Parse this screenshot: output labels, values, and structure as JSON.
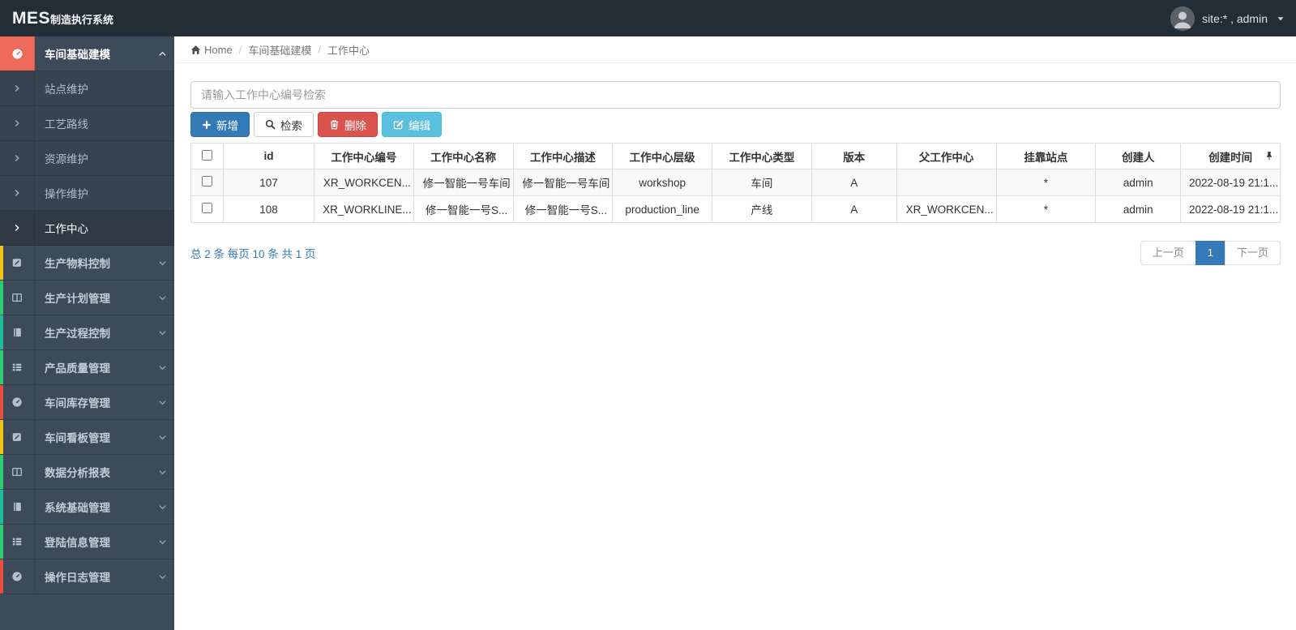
{
  "header": {
    "logo_primary": "MES",
    "logo_secondary": "制造执行系统",
    "user_label": "site:* , admin"
  },
  "breadcrumb": {
    "home": "Home",
    "section": "车间基础建模",
    "page": "工作中心"
  },
  "sidebar": {
    "sections": [
      {
        "label": "车间基础建模",
        "icon": "dashboard-icon",
        "state": "expanded",
        "accent": "#ee6a5b",
        "children": [
          {
            "label": "站点维护"
          },
          {
            "label": "工艺路线"
          },
          {
            "label": "资源维护"
          },
          {
            "label": "操作维护"
          },
          {
            "label": "工作中心",
            "active": true
          }
        ]
      },
      {
        "label": "生产物料控制",
        "icon": "edit-icon",
        "stripe": "#f1c40f"
      },
      {
        "label": "生产计划管理",
        "icon": "columns-icon",
        "stripe": "#2ecc71"
      },
      {
        "label": "生产过程控制",
        "icon": "book-icon",
        "stripe": "#1abc9c"
      },
      {
        "label": "产品质量管理",
        "icon": "list-icon",
        "stripe": "#2ecc71"
      },
      {
        "label": "车间库存管理",
        "icon": "dashboard-icon",
        "stripe": "#e74c3c"
      },
      {
        "label": "车间看板管理",
        "icon": "edit-icon",
        "stripe": "#f1c40f"
      },
      {
        "label": "数据分析报表",
        "icon": "columns-icon",
        "stripe": "#2ecc71"
      },
      {
        "label": "系统基础管理",
        "icon": "book-icon",
        "stripe": "#1abc9c"
      },
      {
        "label": "登陆信息管理",
        "icon": "list-icon",
        "stripe": "#2ecc71"
      },
      {
        "label": "操作日志管理",
        "icon": "dashboard-icon",
        "stripe": "#e74c3c"
      }
    ]
  },
  "search": {
    "placeholder": "请输入工作中心编号检索"
  },
  "toolbar": {
    "add": "新增",
    "search": "检索",
    "delete": "删除",
    "edit": "编辑"
  },
  "table": {
    "columns": [
      "id",
      "工作中心编号",
      "工作中心名称",
      "工作中心描述",
      "工作中心层级",
      "工作中心类型",
      "版本",
      "父工作中心",
      "挂靠站点",
      "创建人",
      "创建时间"
    ],
    "rows": [
      {
        "id": "107",
        "code": "XR_WORKCEN...",
        "name": "修一智能一号车间",
        "desc": "修一智能一号车间",
        "level": "workshop",
        "type": "车间",
        "version": "A",
        "parent": "",
        "station": "*",
        "creator": "admin",
        "created": "2022-08-19 21:1..."
      },
      {
        "id": "108",
        "code": "XR_WORKLINE...",
        "name": "修一智能一号S...",
        "desc": "修一智能一号S...",
        "level": "production_line",
        "type": "产线",
        "version": "A",
        "parent": "XR_WORKCEN...",
        "station": "*",
        "creator": "admin",
        "created": "2022-08-19 21:1..."
      }
    ]
  },
  "pagination": {
    "summary": "总 2 条 每页 10 条 共 1 页",
    "prev": "上一页",
    "current": "1",
    "next": "下一页"
  },
  "colors": {
    "primary": "#337ab7",
    "danger": "#d9534f",
    "info": "#5bc0de",
    "active_accent": "#ee6a5b",
    "header_bg": "#222d36",
    "sidebar_bg": "#3c4a59"
  }
}
